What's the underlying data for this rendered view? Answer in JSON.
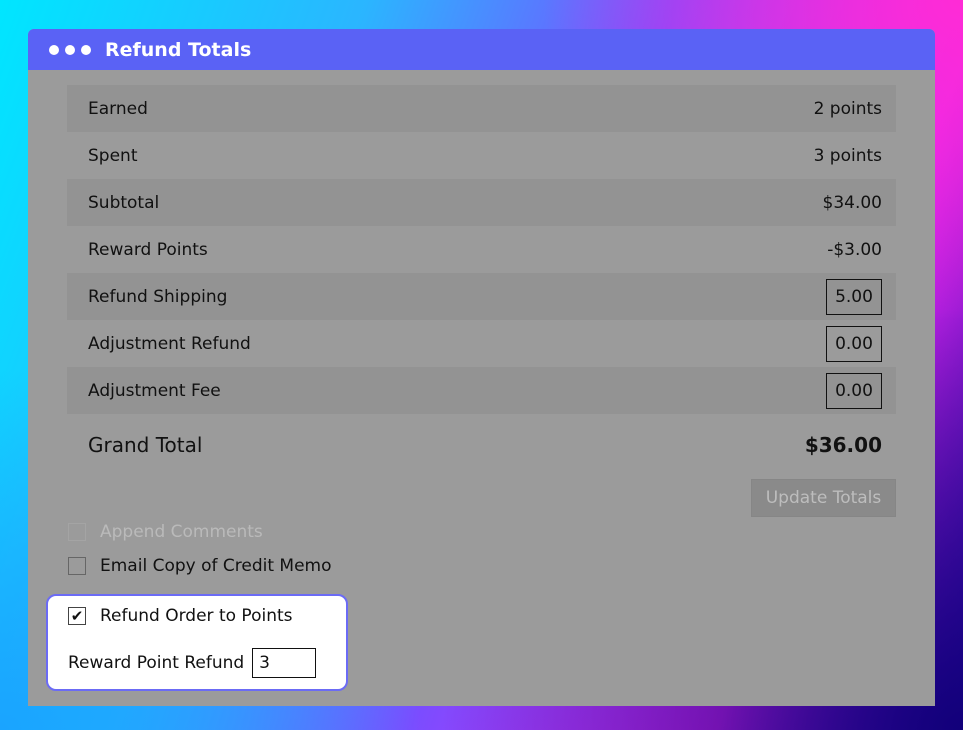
{
  "window": {
    "title": "Refund Totals"
  },
  "totals": {
    "earned": {
      "label": "Earned",
      "value": "2 points"
    },
    "spent": {
      "label": "Spent",
      "value": "3 points"
    },
    "subtotal": {
      "label": "Subtotal",
      "value": "$34.00"
    },
    "reward_points": {
      "label": "Reward Points",
      "value": "-$3.00"
    },
    "refund_shipping": {
      "label": "Refund Shipping",
      "value": "5.00"
    },
    "adjustment_refund": {
      "label": "Adjustment Refund",
      "value": "0.00"
    },
    "adjustment_fee": {
      "label": "Adjustment Fee",
      "value": "0.00"
    }
  },
  "grand_total": {
    "label": "Grand Total",
    "value": "$36.00"
  },
  "update_button": {
    "label": "Update Totals"
  },
  "options": {
    "append_comments": {
      "label": "Append Comments",
      "checked": false,
      "disabled": true
    },
    "email_copy": {
      "label": "Email Copy of Credit Memo",
      "checked": false
    },
    "refund_to_points": {
      "label": "Refund Order to Points",
      "checked": true,
      "check_glyph": "✔"
    },
    "reward_point_refund": {
      "label": "Reward Point Refund",
      "value": "3"
    }
  },
  "colors": {
    "titlebar": "#5a62f5",
    "panel": "#9b9b9b",
    "highlight_border": "#6b6bf5"
  }
}
